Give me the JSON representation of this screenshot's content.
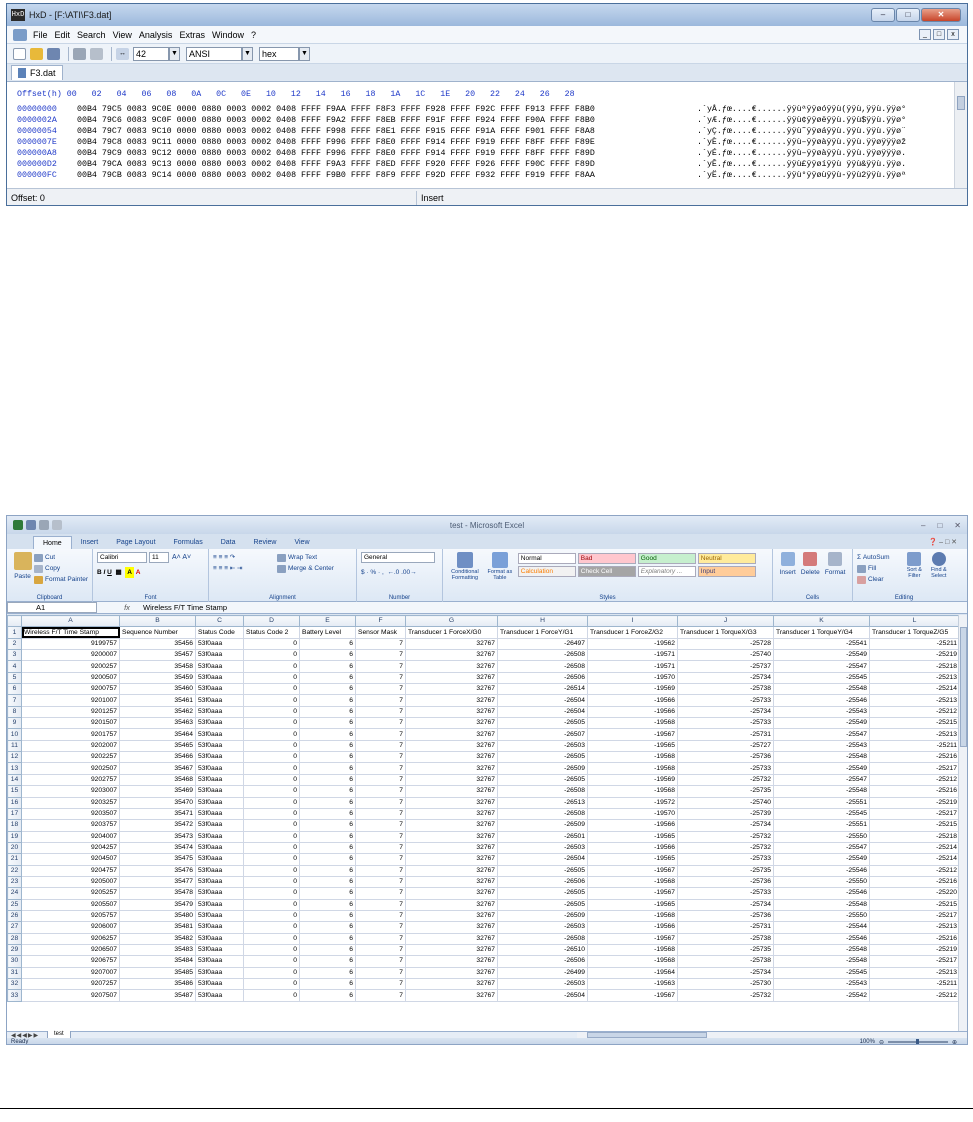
{
  "hxd": {
    "title": "HxD - [F:\\ATI\\F3.dat]",
    "app_icon": "HxD",
    "menu": [
      "File",
      "Edit",
      "Search",
      "View",
      "Analysis",
      "Extras",
      "Window",
      "?"
    ],
    "toolbar": {
      "bytes_per_row": "42",
      "charset": "ANSI",
      "mode": "hex"
    },
    "tab": "F3.dat",
    "header": "Offset(h) 00   02   04   06   08   0A   0C   0E   10   12   14   16   18   1A   1C   1E   20   22   24   26   28",
    "rows": [
      {
        "offset": "00000000",
        "hex": "00B4 79C5 0083 9C0E 0000 0880 0003 0002 0408 FFFF F9AA FFFF F8F3 FFFF F928 FFFF F92C FFFF F913 FFFF F8B0",
        "ascii": ".´yÅ.ƒœ....€......ÿÿùªÿÿøóÿÿù(ÿÿù,ÿÿù.ÿÿø°"
      },
      {
        "offset": "0000002A",
        "hex": "00B4 79C6 0083 9C0F 0000 0880 0003 0002 0408 FFFF F9A2 FFFF F8EB FFFF F91F FFFF F924 FFFF F90A FFFF F8B0",
        "ascii": ".´yÆ.ƒœ....€......ÿÿù¢ÿÿøëÿÿù.ÿÿù$ÿÿù.ÿÿø°"
      },
      {
        "offset": "00000054",
        "hex": "00B4 79C7 0083 9C10 0000 0880 0003 0002 0408 FFFF F998 FFFF F8E1 FFFF F915 FFFF F91A FFFF F901 FFFF F8A8",
        "ascii": ".´yÇ.ƒœ....€......ÿÿù˜ÿÿøáÿÿù.ÿÿù.ÿÿù.ÿÿø¨"
      },
      {
        "offset": "0000007E",
        "hex": "00B4 79C8 0083 9C11 0000 0880 0003 0002 0408 FFFF F996 FFFF F8E0 FFFF F914 FFFF F919 FFFF F8FF FFFF F89E",
        "ascii": ".´yÈ.ƒœ....€......ÿÿù–ÿÿøàÿÿù.ÿÿù.ÿÿøÿÿÿøž"
      },
      {
        "offset": "000000A8",
        "hex": "00B4 79C9 0083 9C12 0000 0880 0003 0002 0408 FFFF F996 FFFF F8E0 FFFF F914 FFFF F919 FFFF F8FF FFFF F89D",
        "ascii": ".´yÉ.ƒœ....€......ÿÿù–ÿÿøàÿÿù.ÿÿù.ÿÿøÿÿÿø."
      },
      {
        "offset": "000000D2",
        "hex": "00B4 79CA 0083 9C13 0000 0880 0003 0002 0408 FFFF F9A3 FFFF F8ED FFFF F920 FFFF F926 FFFF F90C FFFF F89D",
        "ascii": ".´yÊ.ƒœ....€......ÿÿù£ÿÿøíÿÿù ÿÿù&ÿÿù.ÿÿø."
      },
      {
        "offset": "000000FC",
        "hex": "00B4 79CB 0083 9C14 0000 0880 0003 0002 0408 FFFF F9B0 FFFF F8F9 FFFF F92D FFFF F932 FFFF F919 FFFF F8AA",
        "ascii": ".´yË.ƒœ....€......ÿÿù°ÿÿøùÿÿù-ÿÿù2ÿÿù.ÿÿøª"
      }
    ],
    "status": {
      "offset": "Offset: 0",
      "mode": "Insert"
    }
  },
  "excel": {
    "title": "test - Microsoft Excel",
    "ribbon_tabs": [
      "Home",
      "Insert",
      "Page Layout",
      "Formulas",
      "Data",
      "Review",
      "View"
    ],
    "ribbon": {
      "clipboard": {
        "paste": "Paste",
        "cut": "Cut",
        "copy": "Copy",
        "format_painter": "Format Painter",
        "label": "Clipboard"
      },
      "font": {
        "name": "Calibri",
        "size": "11",
        "label": "Font"
      },
      "alignment": {
        "wrap": "Wrap Text",
        "merge": "Merge & Center",
        "label": "Alignment"
      },
      "number": {
        "format": "General",
        "label": "Number"
      },
      "styles": {
        "cond": "Conditional Formatting",
        "table": "Format as Table",
        "cells": [
          "Normal",
          "Bad",
          "Good",
          "Neutral",
          "Calculation",
          "Check Cell",
          "Explanatory ...",
          "Input"
        ],
        "label": "Styles"
      },
      "cells": {
        "insert": "Insert",
        "delete": "Delete",
        "format": "Format",
        "label": "Cells"
      },
      "editing": {
        "autosum": "AutoSum",
        "fill": "Fill",
        "clear": "Clear",
        "sort": "Sort & Filter",
        "find": "Find & Select",
        "label": "Editing"
      }
    },
    "name_box": "A1",
    "fx": "fx",
    "formula": "Wireless F/T Time Stamp",
    "columns": [
      "A",
      "B",
      "C",
      "D",
      "E",
      "F",
      "G",
      "H",
      "I",
      "J",
      "K",
      "L"
    ],
    "headers": [
      "Wireless F/T Time Stamp",
      "Sequence Number",
      "Status Code",
      "Status Code 2",
      "Battery Level",
      "Sensor Mask",
      "Transducer 1 ForceX/G0",
      "Transducer 1 ForceY/G1",
      "Transducer 1 ForceZ/G2",
      "Transducer 1 TorqueX/G3",
      "Transducer 1 TorqueY/G4",
      "Transducer 1 TorqueZ/G5"
    ],
    "rows": [
      [
        "9199757",
        "35456",
        "53f0aaa",
        "0",
        "6",
        "7",
        "32767",
        "-26497",
        "-19562",
        "-25728",
        "-25541",
        "-25211"
      ],
      [
        "9200007",
        "35457",
        "53f0aaa",
        "0",
        "6",
        "7",
        "32767",
        "-26508",
        "-19571",
        "-25740",
        "-25549",
        "-25219"
      ],
      [
        "9200257",
        "35458",
        "53f0aaa",
        "0",
        "6",
        "7",
        "32767",
        "-26508",
        "-19571",
        "-25737",
        "-25547",
        "-25218"
      ],
      [
        "9200507",
        "35459",
        "53f0aaa",
        "0",
        "6",
        "7",
        "32767",
        "-26506",
        "-19570",
        "-25734",
        "-25545",
        "-25213"
      ],
      [
        "9200757",
        "35460",
        "53f0aaa",
        "0",
        "6",
        "7",
        "32767",
        "-26514",
        "-19569",
        "-25738",
        "-25548",
        "-25214"
      ],
      [
        "9201007",
        "35461",
        "53f0aaa",
        "0",
        "6",
        "7",
        "32767",
        "-26504",
        "-19566",
        "-25733",
        "-25546",
        "-25213"
      ],
      [
        "9201257",
        "35462",
        "53f0aaa",
        "0",
        "6",
        "7",
        "32767",
        "-26504",
        "-19566",
        "-25734",
        "-25543",
        "-25212"
      ],
      [
        "9201507",
        "35463",
        "53f0aaa",
        "0",
        "6",
        "7",
        "32767",
        "-26505",
        "-19568",
        "-25733",
        "-25549",
        "-25215"
      ],
      [
        "9201757",
        "35464",
        "53f0aaa",
        "0",
        "6",
        "7",
        "32767",
        "-26507",
        "-19567",
        "-25731",
        "-25547",
        "-25213"
      ],
      [
        "9202007",
        "35465",
        "53f0aaa",
        "0",
        "6",
        "7",
        "32767",
        "-26503",
        "-19565",
        "-25727",
        "-25543",
        "-25211"
      ],
      [
        "9202257",
        "35466",
        "53f0aaa",
        "0",
        "6",
        "7",
        "32767",
        "-26505",
        "-19568",
        "-25736",
        "-25548",
        "-25216"
      ],
      [
        "9202507",
        "35467",
        "53f0aaa",
        "0",
        "6",
        "7",
        "32767",
        "-26509",
        "-19568",
        "-25733",
        "-25549",
        "-25217"
      ],
      [
        "9202757",
        "35468",
        "53f0aaa",
        "0",
        "6",
        "7",
        "32767",
        "-26505",
        "-19569",
        "-25732",
        "-25547",
        "-25212"
      ],
      [
        "9203007",
        "35469",
        "53f0aaa",
        "0",
        "6",
        "7",
        "32767",
        "-26508",
        "-19568",
        "-25735",
        "-25548",
        "-25216"
      ],
      [
        "9203257",
        "35470",
        "53f0aaa",
        "0",
        "6",
        "7",
        "32767",
        "-26513",
        "-19572",
        "-25740",
        "-25551",
        "-25219"
      ],
      [
        "9203507",
        "35471",
        "53f0aaa",
        "0",
        "6",
        "7",
        "32767",
        "-26508",
        "-19570",
        "-25739",
        "-25545",
        "-25217"
      ],
      [
        "9203757",
        "35472",
        "53f0aaa",
        "0",
        "6",
        "7",
        "32767",
        "-26509",
        "-19566",
        "-25734",
        "-25551",
        "-25215"
      ],
      [
        "9204007",
        "35473",
        "53f0aaa",
        "0",
        "6",
        "7",
        "32767",
        "-26501",
        "-19565",
        "-25732",
        "-25550",
        "-25218"
      ],
      [
        "9204257",
        "35474",
        "53f0aaa",
        "0",
        "6",
        "7",
        "32767",
        "-26503",
        "-19566",
        "-25732",
        "-25547",
        "-25214"
      ],
      [
        "9204507",
        "35475",
        "53f0aaa",
        "0",
        "6",
        "7",
        "32767",
        "-26504",
        "-19565",
        "-25733",
        "-25549",
        "-25214"
      ],
      [
        "9204757",
        "35476",
        "53f0aaa",
        "0",
        "6",
        "7",
        "32767",
        "-26505",
        "-19567",
        "-25735",
        "-25546",
        "-25212"
      ],
      [
        "9205007",
        "35477",
        "53f0aaa",
        "0",
        "6",
        "7",
        "32767",
        "-26506",
        "-19568",
        "-25736",
        "-25550",
        "-25216"
      ],
      [
        "9205257",
        "35478",
        "53f0aaa",
        "0",
        "6",
        "7",
        "32767",
        "-26505",
        "-19567",
        "-25733",
        "-25546",
        "-25220"
      ],
      [
        "9205507",
        "35479",
        "53f0aaa",
        "0",
        "6",
        "7",
        "32767",
        "-26505",
        "-19565",
        "-25734",
        "-25548",
        "-25215"
      ],
      [
        "9205757",
        "35480",
        "53f0aaa",
        "0",
        "6",
        "7",
        "32767",
        "-26509",
        "-19568",
        "-25736",
        "-25550",
        "-25217"
      ],
      [
        "9206007",
        "35481",
        "53f0aaa",
        "0",
        "6",
        "7",
        "32767",
        "-26503",
        "-19566",
        "-25731",
        "-25544",
        "-25213"
      ],
      [
        "9206257",
        "35482",
        "53f0aaa",
        "0",
        "6",
        "7",
        "32767",
        "-26508",
        "-19567",
        "-25738",
        "-25546",
        "-25216"
      ],
      [
        "9206507",
        "35483",
        "53f0aaa",
        "0",
        "6",
        "7",
        "32767",
        "-26510",
        "-19568",
        "-25735",
        "-25548",
        "-25219"
      ],
      [
        "9206757",
        "35484",
        "53f0aaa",
        "0",
        "6",
        "7",
        "32767",
        "-26506",
        "-19568",
        "-25738",
        "-25548",
        "-25217"
      ],
      [
        "9207007",
        "35485",
        "53f0aaa",
        "0",
        "6",
        "7",
        "32767",
        "-26499",
        "-19564",
        "-25734",
        "-25545",
        "-25213"
      ],
      [
        "9207257",
        "35486",
        "53f0aaa",
        "0",
        "6",
        "7",
        "32767",
        "-26503",
        "-19563",
        "-25730",
        "-25543",
        "-25211"
      ],
      [
        "9207507",
        "35487",
        "53f0aaa",
        "0",
        "6",
        "7",
        "32767",
        "-26504",
        "-19567",
        "-25732",
        "-25542",
        "-25212"
      ]
    ],
    "sheet_tab": "test",
    "status": {
      "ready": "Ready",
      "zoom": "100%"
    }
  },
  "colors": {
    "hex_offset_blue": "#1e38c8",
    "excel_header": "#e4ebf4",
    "ribbon_blue": "#15428b"
  }
}
